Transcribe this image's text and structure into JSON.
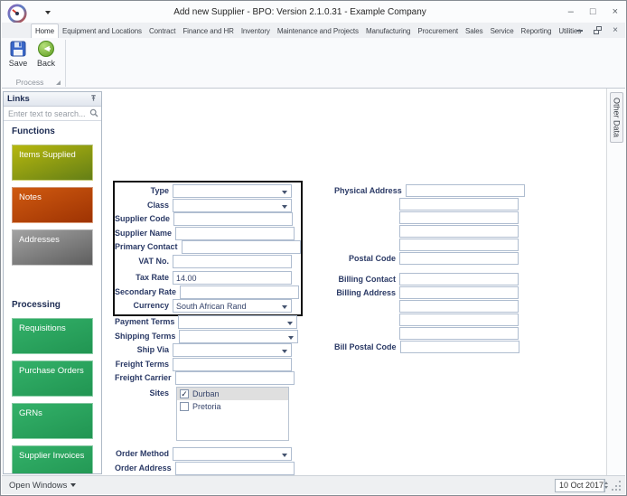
{
  "window": {
    "title": "Add new Supplier - BPO: Version 2.1.0.31 - Example Company",
    "controls": {
      "minimize": "–",
      "maximize": "□",
      "close": "×"
    }
  },
  "ribbon": {
    "tabs": [
      "Home",
      "Equipment and Locations",
      "Contract",
      "Finance and HR",
      "Inventory",
      "Maintenance and Projects",
      "Manufacturing",
      "Procurement",
      "Sales",
      "Service",
      "Reporting",
      "Utilities"
    ],
    "active_tab": "Home",
    "save_label": "Save",
    "back_label": "Back",
    "group_label": "Process"
  },
  "sidebar": {
    "header_label": "Links",
    "search_placeholder": "Enter text to search...",
    "sections": [
      {
        "heading": "Functions",
        "items": [
          {
            "label": "Items Supplied",
            "color_top": "#b6b70e",
            "color_bottom": "#647f16"
          },
          {
            "label": "Notes",
            "color_top": "#d05a10",
            "color_bottom": "#9e3303"
          },
          {
            "label": "Addresses",
            "color_top": "#a2a2a2",
            "color_bottom": "#5e5e5e"
          }
        ]
      },
      {
        "heading": "Processing",
        "items": [
          {
            "label": "Requisitions",
            "color_top": "#33b169",
            "color_bottom": "#219552"
          },
          {
            "label": "Purchase Orders",
            "color_top": "#33b169",
            "color_bottom": "#219552"
          },
          {
            "label": "GRNs",
            "color_top": "#33b169",
            "color_bottom": "#219552"
          },
          {
            "label": "Supplier Invoices",
            "color_top": "#33b169",
            "color_bottom": "#219552"
          }
        ]
      }
    ]
  },
  "form": {
    "left": {
      "primary_fields": [
        {
          "label": "Type",
          "type": "dropdown",
          "value": ""
        },
        {
          "label": "Class",
          "type": "dropdown",
          "value": ""
        },
        {
          "label": "Supplier Code",
          "type": "text",
          "value": ""
        },
        {
          "label": "Supplier Name",
          "type": "text",
          "value": ""
        },
        {
          "label": "Primary Contact",
          "type": "text",
          "value": ""
        },
        {
          "label": "VAT No.",
          "type": "text",
          "value": ""
        },
        {
          "label": "Tax Rate",
          "type": "text",
          "value": "14.00",
          "gap_before": true
        },
        {
          "label": "Secondary Rate",
          "type": "text",
          "value": ""
        },
        {
          "label": "Currency",
          "type": "dropdown",
          "value": "South African Rand"
        }
      ],
      "shipping_fields": [
        {
          "label": "Payment Terms",
          "type": "dropdown",
          "value": ""
        },
        {
          "label": "Shipping Terms",
          "type": "dropdown",
          "value": ""
        },
        {
          "label": "Ship Via",
          "type": "dropdown",
          "value": ""
        },
        {
          "label": "Freight Terms",
          "type": "text",
          "value": ""
        },
        {
          "label": "Freight Carrier",
          "type": "text",
          "value": ""
        }
      ],
      "sites": {
        "label": "Sites",
        "options": [
          {
            "name": "Durban",
            "checked": true,
            "highlighted": true
          },
          {
            "name": "Pretoria",
            "checked": false,
            "highlighted": false
          }
        ]
      },
      "order_fields": [
        {
          "label": "Order Method",
          "type": "dropdown",
          "value": ""
        },
        {
          "label": "Order Address",
          "type": "text",
          "value": ""
        }
      ]
    },
    "right": {
      "physical_address_label": "Physical Address",
      "physical_address_lines": 5,
      "postal_code_label": "Postal Code",
      "billing_contact_label": "Billing Contact",
      "billing_address_label": "Billing Address",
      "billing_address_lines": 4,
      "bill_postal_code_label": "Bill Postal Code"
    }
  },
  "right_dock": {
    "tab_label": "Other Data"
  },
  "statusbar": {
    "open_windows_label": "Open Windows",
    "date_value": "10 Oct 2017"
  },
  "icons": {
    "check": "✓"
  },
  "colors": {
    "accent_green": "#2aa55c",
    "label_navy": "#2b3a66",
    "field_border": "#afbdd0",
    "highlight_box": "#111111"
  }
}
